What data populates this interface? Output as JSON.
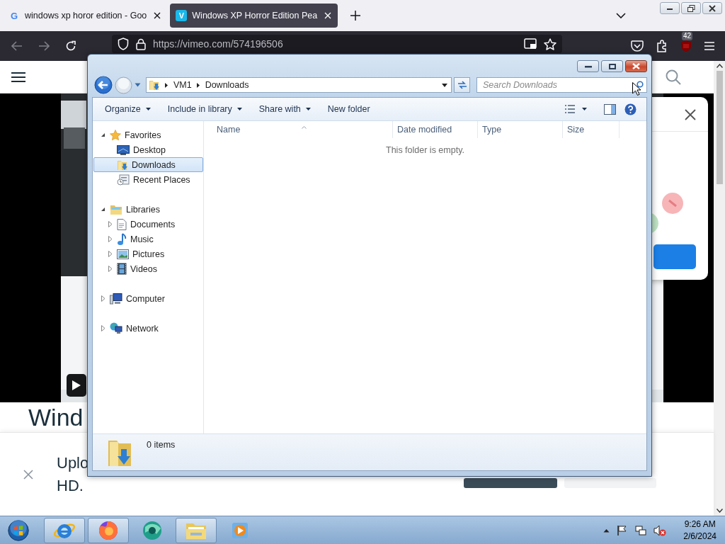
{
  "browser": {
    "tabs": [
      {
        "favicon": "G",
        "kind": "plain",
        "title": "windows xp horor edition - Goo",
        "selected": false
      },
      {
        "favicon": "V",
        "kind": "tile",
        "title": "Windows XP Horror Edition Pea",
        "selected": true
      }
    ],
    "url": "https://vimeo.com/574196506",
    "extension_badge": "42"
  },
  "page": {
    "heading": "Wind",
    "banner_lines": [
      "Uplo",
      "HD."
    ]
  },
  "explorer": {
    "breadcrumb": [
      "VM1",
      "Downloads"
    ],
    "search_placeholder": "Search Downloads",
    "toolbar": [
      {
        "label": "Organize",
        "dropdown": true
      },
      {
        "label": "Include in library",
        "dropdown": true
      },
      {
        "label": "Share with",
        "dropdown": true
      },
      {
        "label": "New folder",
        "dropdown": false
      }
    ],
    "nav": [
      {
        "label": "Favorites",
        "kind": "star",
        "expanded": true,
        "selected": false,
        "children": [
          {
            "label": "Desktop",
            "kind": "desktop",
            "selected": false
          },
          {
            "label": "Downloads",
            "kind": "downloads",
            "selected": true
          },
          {
            "label": "Recent Places",
            "kind": "recent",
            "selected": false
          }
        ]
      },
      {
        "label": "Libraries",
        "kind": "libraries",
        "expanded": true,
        "selected": false,
        "children": [
          {
            "label": "Documents",
            "kind": "documents",
            "expanded": false,
            "selected": false
          },
          {
            "label": "Music",
            "kind": "music",
            "expanded": false,
            "selected": false
          },
          {
            "label": "Pictures",
            "kind": "pictures",
            "expanded": false,
            "selected": false
          },
          {
            "label": "Videos",
            "kind": "videos",
            "expanded": false,
            "selected": false
          }
        ]
      },
      {
        "label": "Computer",
        "kind": "computer",
        "expanded": false,
        "selected": false
      },
      {
        "label": "Network",
        "kind": "network",
        "expanded": false,
        "selected": false
      }
    ],
    "columns": [
      "Name",
      "Date modified",
      "Type",
      "Size"
    ],
    "empty_message": "This folder is empty.",
    "status": "0 items"
  },
  "taskbar": {
    "apps": [
      {
        "kind": "e-browser",
        "running": true
      },
      {
        "kind": "fox",
        "running": true
      },
      {
        "kind": "globe",
        "running": false
      },
      {
        "kind": "folder",
        "running": true
      },
      {
        "kind": "media",
        "running": false
      }
    ],
    "time": "9:26 AM",
    "date": "2/6/2024"
  }
}
